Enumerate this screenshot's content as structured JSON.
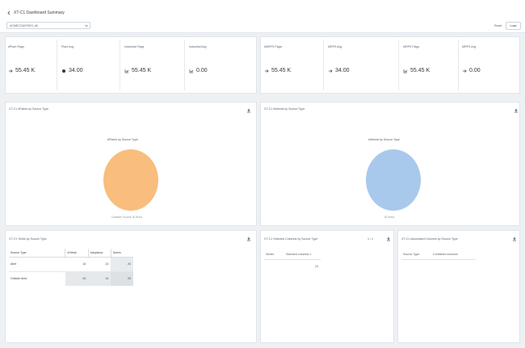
{
  "header": {
    "title": "XT-C1 Dashboard Summary",
    "filter_value": "ACMECOUNTIES, All"
  },
  "header_buttons": {
    "reset": "Reset",
    "view": "Load"
  },
  "kpis": [
    {
      "label": "#Plant Flags",
      "value": "55.45 K",
      "icon": "arrow-icon"
    },
    {
      "label": "Plant Avg",
      "value": "34.00",
      "icon": "dot-icon"
    },
    {
      "label": "Industrial Flags",
      "value": "55.45 K",
      "icon": "growth-icon"
    },
    {
      "label": "Industrial Avg",
      "value": "0.00",
      "icon": "growth-icon"
    },
    {
      "label": "#MRPS Flags",
      "value": "55.45 K",
      "icon": "arrow-icon"
    },
    {
      "label": "MRPS Avg",
      "value": "34.00",
      "icon": "arrow-icon"
    },
    {
      "label": "MRPS Flags",
      "value": "55.45 K",
      "icon": "growth-icon"
    },
    {
      "label": "MRPS Avg",
      "value": "0.00",
      "icon": "arrow-icon"
    }
  ],
  "pie_left": {
    "panel_title": "XT-C1 #Plants by Source Type",
    "chart_title": "#Plants by Source Type",
    "legend": "Outside Source   ID Area",
    "color": "#f9bd7d"
  },
  "pie_right": {
    "panel_title": "XT-C1 #Weeds by Source Type",
    "chart_title": "#Weeds by Source Type",
    "legend": "ID Area",
    "color": "#a9c9ec"
  },
  "table_panel": {
    "title": "XT-C1 Yields by Source Type",
    "headers": [
      "Source Type",
      "#Yields",
      "Adoptions",
      "Series"
    ],
    "rows": [
      {
        "name": "Alert",
        "v1": "14",
        "v2": "14",
        "v3": "24"
      },
      {
        "name": "Outside Area",
        "v1": "24",
        "v2": "14",
        "v3": "24"
      }
    ]
  },
  "mid_panel": {
    "title": "XT-C1 Selected Columns by Source Type",
    "pager": "1 / 1",
    "filter_a": "Series",
    "filter_b": "Selected columns 1",
    "value": "24"
  },
  "right_panel": {
    "title": "XT-C1 Associated Columns by Source Type",
    "filter_a": "Source Type",
    "filter_b": "Combined columns"
  }
}
